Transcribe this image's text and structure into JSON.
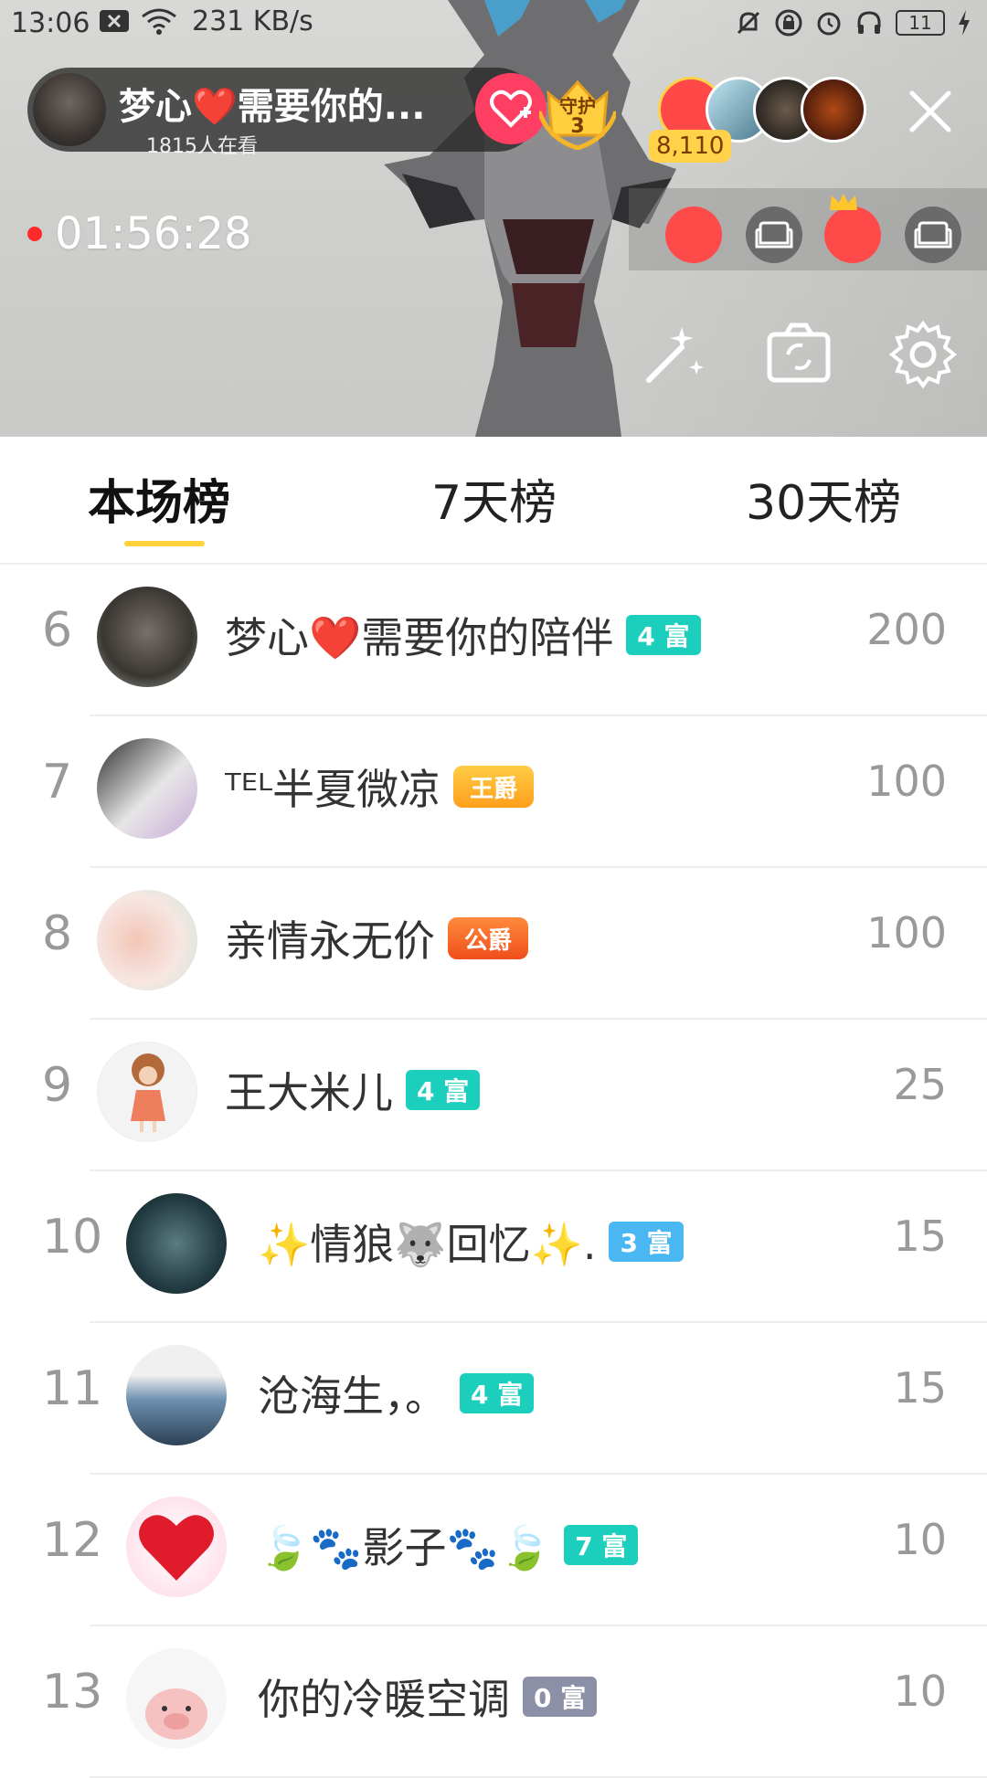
{
  "status_bar": {
    "time": "13:06",
    "network_speed": "231 KB/s",
    "battery": "11",
    "icons": [
      "sim-x-icon",
      "wifi-icon",
      "mute-bell-icon",
      "lock-icon",
      "alarm-icon",
      "headphones-icon",
      "battery-icon",
      "charging-icon"
    ]
  },
  "live": {
    "host_name": "梦心❤️需要你的...",
    "viewers_text": "1815人在看",
    "guard_label": "守护",
    "guard_count": "3",
    "fan_count": "8,110",
    "timer": "01:56:28"
  },
  "tabs": [
    {
      "label": "本场榜",
      "active": true
    },
    {
      "label": "7天榜",
      "active": false
    },
    {
      "label": "30天榜",
      "active": false
    }
  ],
  "leaderboard": [
    {
      "rank": "6",
      "name": "梦心❤️需要你的陪伴",
      "badge_type": "level",
      "badge": "4 富",
      "badge_color": "#1ccfbd",
      "score": "200"
    },
    {
      "rank": "7",
      "name": "ᵀᴱᴸ半夏微凉",
      "badge_type": "noble",
      "badge": "王爵",
      "badge_color": "#ffb12a",
      "score": "100"
    },
    {
      "rank": "8",
      "name": "亲情永无价",
      "badge_type": "noble",
      "badge": "公爵",
      "badge_color": "#ff6b2a",
      "score": "100"
    },
    {
      "rank": "9",
      "name": "王大米儿",
      "badge_type": "level",
      "badge": "4 富",
      "badge_color": "#1ccfbd",
      "score": "25"
    },
    {
      "rank": "10",
      "name": "✨情狼🐺回忆✨.",
      "badge_type": "level",
      "badge": "3 富",
      "badge_color": "#4ab6f2",
      "score": "15"
    },
    {
      "rank": "11",
      "name": "沧海生，。",
      "badge_type": "level",
      "badge": "4 富",
      "badge_color": "#1ccfbd",
      "score": "15"
    },
    {
      "rank": "12",
      "name": "🍃🐾影子🐾🍃",
      "badge_type": "level",
      "badge": "7 富",
      "badge_color": "#1ccfbd",
      "score": "10"
    },
    {
      "rank": "13",
      "name": "你的冷暖空调",
      "badge_type": "level",
      "badge": "0 富",
      "badge_color": "#8c90a6",
      "score": "10"
    }
  ]
}
